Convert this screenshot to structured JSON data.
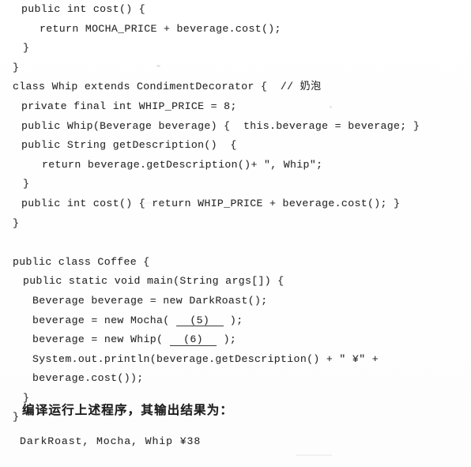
{
  "document": {
    "type": "scanned-textbook-page",
    "language": "java",
    "background_color": "#ffffff",
    "ink_color": "#2a2a2a"
  },
  "code": {
    "lines": [
      {
        "indent": 27,
        "text": "public int cost() {"
      },
      {
        "indent": 50,
        "text": "return MOCHA_PRICE + beverage.cost();"
      },
      {
        "indent": 29,
        "text": "}"
      },
      {
        "indent": 16,
        "text": "}"
      },
      {
        "indent": 16,
        "text": "class Whip extends CondimentDecorator {  // ",
        "cjk": "奶泡"
      },
      {
        "indent": 27,
        "text": "private final int WHIP_PRICE = 8;"
      },
      {
        "indent": 27,
        "text": "public Whip(Beverage beverage) {  this.beverage = beverage; }"
      },
      {
        "indent": 27,
        "text": "public String getDescription()  {"
      },
      {
        "indent": 53,
        "text": "return beverage.getDescription()+ \", Whip\";"
      },
      {
        "indent": 29,
        "text": "}"
      },
      {
        "indent": 27,
        "text": "public int cost() { return WHIP_PRICE + beverage.cost(); }"
      },
      {
        "indent": 16,
        "text": "}"
      },
      {
        "indent": 0,
        "text": ""
      },
      {
        "indent": 16,
        "text": "public class Coffee {"
      },
      {
        "indent": 29,
        "text": "public static void main(String args[]) {"
      },
      {
        "indent": 41,
        "text": "Beverage beverage = new DarkRoast();"
      },
      {
        "indent": 41,
        "pre": "beverage = new Mocha( ",
        "slot": "(5)",
        "post": " );"
      },
      {
        "indent": 41,
        "pre": "beverage = new Whip( ",
        "slot": "(6)",
        "post": " );"
      },
      {
        "indent": 41,
        "text": "System.out.println(beverage.getDescription() + \" ¥\" +"
      },
      {
        "indent": 41,
        "text": "beverage.cost());"
      },
      {
        "indent": 29,
        "text": "}"
      },
      {
        "indent": 16,
        "text": "}"
      }
    ]
  },
  "prose": {
    "question_prompt": "编译运行上述程序，其输出结果为："
  },
  "output": {
    "program_output": "DarkRoast, Mocha, Whip ¥38"
  },
  "answers": {
    "blank_5_label": "(5)",
    "blank_6_label": "(6)"
  }
}
